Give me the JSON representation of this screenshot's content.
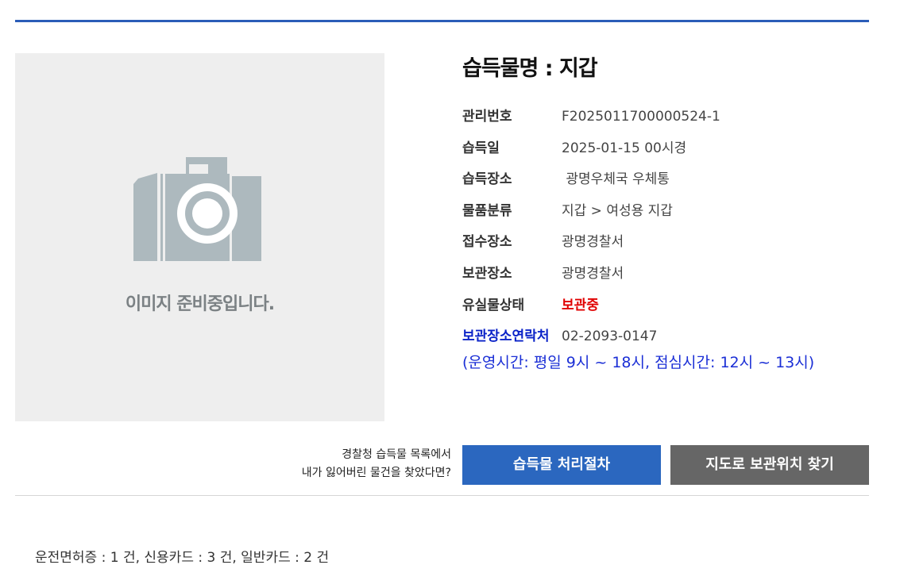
{
  "photo": {
    "placeholder_text": "이미지 준비중입니다."
  },
  "item": {
    "title": "습득물명 : 지갑",
    "fields": [
      {
        "label": "관리번호",
        "value": "F2025011700000524-1"
      },
      {
        "label": "습득일",
        "value": "2025-01-15 00시경"
      },
      {
        "label": "습득장소",
        "value": " 광명우체국 우체통"
      },
      {
        "label": "물품분류",
        "value": "지갑 > 여성용 지갑"
      },
      {
        "label": "접수장소",
        "value": "광명경찰서"
      },
      {
        "label": "보관장소",
        "value": "광명경찰서"
      },
      {
        "label": "유실물상태",
        "value": "보관중"
      },
      {
        "label": "보관장소연락처",
        "value": "02-2093-0147"
      }
    ],
    "hours": "(운영시간: 평일 9시 ~ 18시, 점심시간: 12시 ~ 13시)"
  },
  "cta": {
    "note_line1": "경찰청 습득물 목록에서",
    "note_line2": "내가 잃어버린 물건을 찾았다면?",
    "procedure_label": "습득물 처리절차",
    "map_label": "지도로 보관위치 찾기"
  },
  "summary": "운전면허증 : 1 건, 신용카드 : 3 건, 일반카드 : 2 건",
  "colors": {
    "accent": "#2b5db8",
    "status": "#e00000",
    "contact": "#0b23c8",
    "map_button": "#666666"
  }
}
